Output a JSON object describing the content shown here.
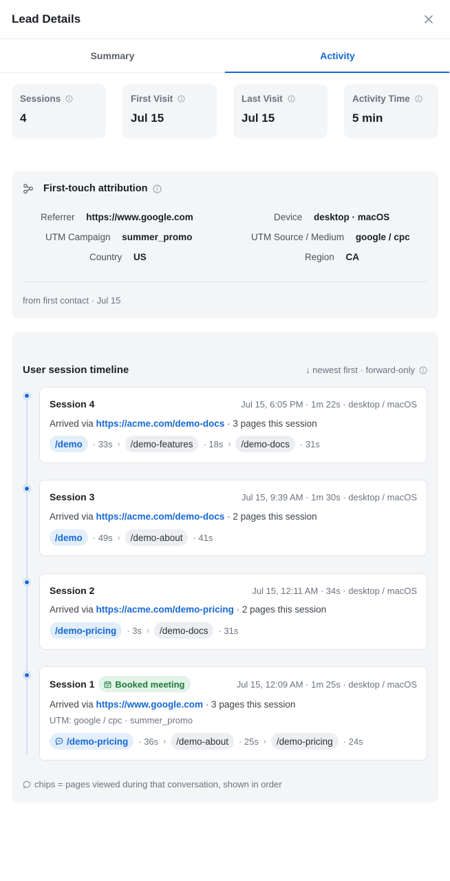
{
  "header": {
    "title": "Lead Details"
  },
  "tabs": [
    {
      "label": "Summary",
      "active": false
    },
    {
      "label": "Activity",
      "active": true
    }
  ],
  "stats": [
    {
      "label": "Sessions",
      "value": "4"
    },
    {
      "label": "First Visit",
      "value": "Jul 15"
    },
    {
      "label": "Last Visit",
      "value": "Jul 15"
    },
    {
      "label": "Activity Time",
      "value": "5 min"
    }
  ],
  "attribution": {
    "title": "First-touch attribution",
    "fields": {
      "referrer": {
        "label": "Referrer",
        "value": "https://www.google.com"
      },
      "device": {
        "label": "Device",
        "value": "desktop · macOS"
      },
      "utm_campaign": {
        "label": "UTM Campaign",
        "value": "summer_promo"
      },
      "utm_source": {
        "label": "UTM Source / Medium",
        "value": "google / cpc"
      },
      "country": {
        "label": "Country",
        "value": "US"
      },
      "region": {
        "label": "Region",
        "value": "CA"
      }
    },
    "footer": "from first contact · Jul 15"
  },
  "timeline": {
    "title": "User session timeline",
    "meta": "↓ newest first · forward-only",
    "footer": "chips = pages viewed during that conversation, shown in order",
    "sessions": [
      {
        "name": "Session 4",
        "time": "Jul 15, 6:05 PM · 1m 22s · desktop / macOS",
        "arrived_prefix": "Arrived via",
        "arrived_url": "https://acme.com/demo-docs",
        "arrived_suffix": "· 3 pages this session",
        "pages": [
          {
            "path": "/demo",
            "dur": "· 33s"
          },
          {
            "path": "/demo-features",
            "dur": "· 18s"
          },
          {
            "path": "/demo-docs",
            "dur": "· 31s"
          }
        ]
      },
      {
        "name": "Session 3",
        "time": "Jul 15, 9:39 AM · 1m 30s · desktop / macOS",
        "arrived_prefix": "Arrived via",
        "arrived_url": "https://acme.com/demo-docs",
        "arrived_suffix": "· 2 pages this session",
        "pages": [
          {
            "path": "/demo",
            "dur": "· 49s"
          },
          {
            "path": "/demo-about",
            "dur": "· 41s"
          }
        ]
      },
      {
        "name": "Session 2",
        "time": "Jul 15, 12:11 AM · 34s · desktop / macOS",
        "arrived_prefix": "Arrived via",
        "arrived_url": "https://acme.com/demo-pricing",
        "arrived_suffix": "· 2 pages this session",
        "pages": [
          {
            "path": "/demo-pricing",
            "dur": "· 3s"
          },
          {
            "path": "/demo-docs",
            "dur": "· 31s"
          }
        ]
      },
      {
        "name": "Session 1",
        "badge": "Booked meeting",
        "time": "Jul 15, 12:09 AM · 1m 25s · desktop / macOS",
        "arrived_prefix": "Arrived via",
        "arrived_url": "https://www.google.com",
        "arrived_suffix": "· 3 pages this session",
        "utm": "UTM: google / cpc · summer_promo",
        "pages": [
          {
            "path": "/demo-pricing",
            "dur": "· 36s"
          },
          {
            "path": "/demo-about",
            "dur": "· 25s"
          },
          {
            "path": "/demo-pricing",
            "dur": "· 24s"
          }
        ]
      }
    ]
  },
  "colors": {
    "accent": "#1668d3",
    "card_bg": "#f4f5f7",
    "badge_green": "#1f7a3a"
  }
}
